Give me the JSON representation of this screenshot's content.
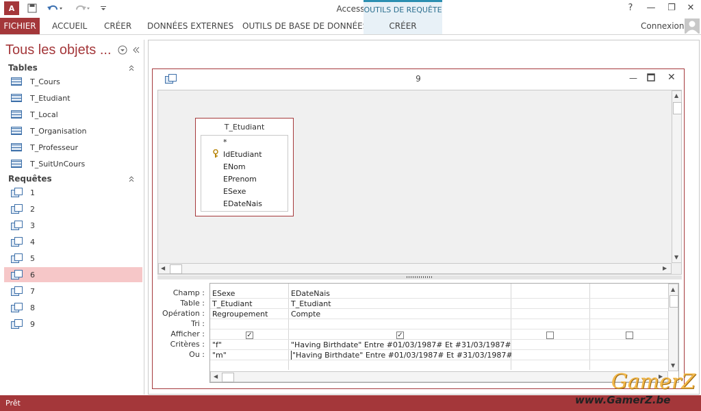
{
  "app": {
    "logo_text": "A",
    "window_title": "Access",
    "context_group": "OUTILS DE REQUÊTE"
  },
  "window_controls": {
    "help": "?",
    "minimize": "—",
    "restore": "❐",
    "close": "✕"
  },
  "ribbon": {
    "tabs": [
      "FICHIER",
      "ACCUEIL",
      "CRÉER",
      "DONNÉES EXTERNES",
      "OUTILS DE BASE DE DONNÉES"
    ],
    "context_tab": "CRÉER",
    "account": "Connexion"
  },
  "nav": {
    "title": "Tous les objets ...",
    "groups": {
      "tables": {
        "label": "Tables",
        "items": [
          "T_Cours",
          "T_Etudiant",
          "T_Local",
          "T_Organisation",
          "T_Professeur",
          "T_SuitUnCours"
        ]
      },
      "queries": {
        "label": "Requêtes",
        "items": [
          "1",
          "2",
          "3",
          "4",
          "5",
          "6",
          "7",
          "8",
          "9"
        ],
        "selected": "6"
      }
    }
  },
  "query_window": {
    "title": "9",
    "field_list": {
      "table": "T_Etudiant",
      "fields": [
        "*",
        "IdEtudiant",
        "ENom",
        "EPrenom",
        "ESexe",
        "EDateNais"
      ],
      "key_field": "IdEtudiant"
    },
    "grid": {
      "row_labels": [
        "Champ :",
        "Table :",
        "Opération :",
        "Tri :",
        "Afficher :",
        "Critères :",
        "Ou :"
      ],
      "columns": [
        {
          "champ": "ESexe",
          "table": "T_Etudiant",
          "operation": "Regroupement",
          "tri": "",
          "afficher": true,
          "criteres": "\"f\"",
          "ou": "\"m\""
        },
        {
          "champ": "EDateNais",
          "table": "T_Etudiant",
          "operation": "Compte",
          "tri": "",
          "afficher": true,
          "criteres": "\"Having Birthdate\" Entre #01/03/1987# Et #31/03/1987#",
          "ou": "\"Having Birthdate\" Entre #01/03/1987# Et #31/03/1987#"
        },
        {
          "champ": "",
          "table": "",
          "operation": "",
          "tri": "",
          "afficher": false,
          "criteres": "",
          "ou": ""
        },
        {
          "champ": "",
          "table": "",
          "operation": "",
          "tri": "",
          "afficher": false,
          "criteres": "",
          "ou": ""
        }
      ]
    }
  },
  "status": {
    "text": "Prêt"
  },
  "watermark": {
    "brand": "GamerZ",
    "url": "www.GamerZ.be"
  },
  "colors": {
    "accent": "#a4373a",
    "context": "#2b8fb1",
    "selection": "#f6c7c8"
  }
}
